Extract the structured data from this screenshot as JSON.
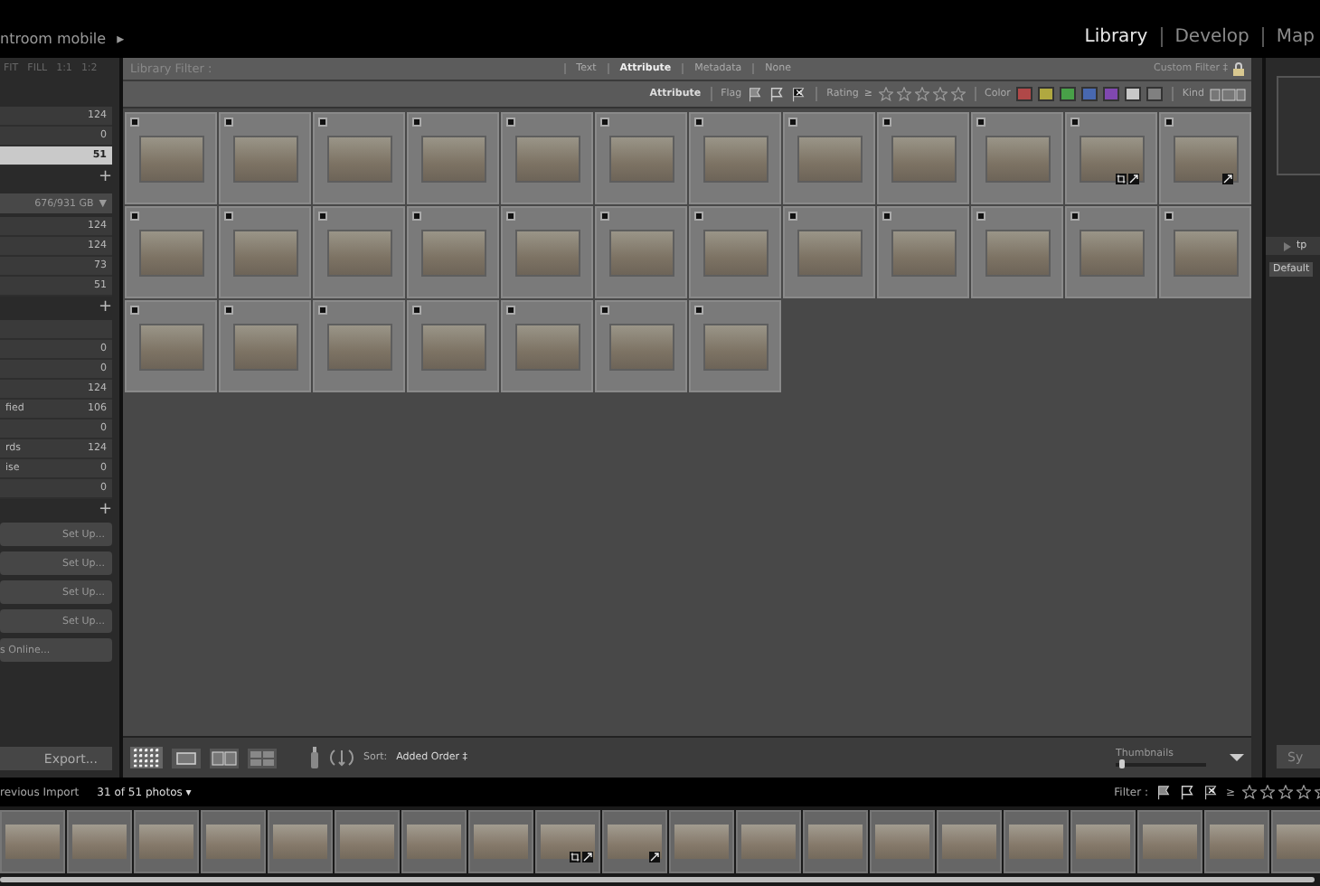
{
  "top_bar": {
    "identity": "ntroom mobile",
    "identity_arrow": "▸",
    "modules": [
      {
        "label": "Library",
        "selected": true
      },
      {
        "label": "Develop",
        "selected": false
      },
      {
        "label": "Map",
        "selected": false
      }
    ]
  },
  "left_panel": {
    "zoom_options": [
      "FIT",
      "FILL",
      "1:1",
      "1:2"
    ],
    "catalog_rows": [
      {
        "count": "124",
        "selected": false
      },
      {
        "count": "0",
        "selected": false
      },
      {
        "count": "51",
        "selected": true
      }
    ],
    "folders": {
      "add": "+",
      "volume": "676/931 GB",
      "volume_arrow": "▼",
      "rows": [
        {
          "count": "124"
        },
        {
          "count": "124"
        },
        {
          "count": "73"
        },
        {
          "count": "51"
        }
      ]
    },
    "collections": {
      "add": "+",
      "rows": [
        {
          "count": "0"
        },
        {
          "count": "0"
        },
        {
          "count": "124"
        },
        {
          "label": "fied",
          "count": "106"
        },
        {
          "count": "0"
        },
        {
          "label": "rds",
          "count": "124"
        },
        {
          "label": "ise",
          "count": "0"
        },
        {
          "count": "0"
        }
      ]
    },
    "publish": {
      "add": "+",
      "services": [
        {
          "action": "Set Up..."
        },
        {
          "action": "Set Up..."
        },
        {
          "action": "Set Up..."
        },
        {
          "action": "Set Up..."
        }
      ],
      "find_more": "s Online..."
    },
    "export_button": "Export..."
  },
  "center": {
    "filter_bar": {
      "title": "Library Filter :",
      "tabs": [
        {
          "label": "Text",
          "selected": false
        },
        {
          "label": "Attribute",
          "selected": true
        },
        {
          "label": "Metadata",
          "selected": false
        },
        {
          "label": "None",
          "selected": false
        }
      ],
      "preset": "Custom Filter ‡"
    },
    "attribute_bar": {
      "label": "Attribute",
      "flag_label": "Flag",
      "rating_label": "Rating",
      "rating_op": "≥",
      "stars": 0,
      "color_label": "Color",
      "colors": [
        {
          "color": "#b04848"
        },
        {
          "color": "#b0a840"
        },
        {
          "color": "#48a048"
        },
        {
          "color": "#4868b0"
        },
        {
          "color": "#8048b0"
        },
        {
          "color": "#c8c8c8"
        },
        {
          "color": "#808080"
        }
      ],
      "kind_label": "Kind"
    },
    "photos": [
      {
        "adjusted": false,
        "cropped": false
      },
      {
        "adjusted": false,
        "cropped": false
      },
      {
        "adjusted": false,
        "cropped": false
      },
      {
        "adjusted": false,
        "cropped": false
      },
      {
        "adjusted": false,
        "cropped": false
      },
      {
        "adjusted": false,
        "cropped": false
      },
      {
        "adjusted": false,
        "cropped": false
      },
      {
        "adjusted": false,
        "cropped": false
      },
      {
        "adjusted": false,
        "cropped": false
      },
      {
        "adjusted": false,
        "cropped": false
      },
      {
        "adjusted": true,
        "cropped": true
      },
      {
        "adjusted": true,
        "cropped": false
      },
      {
        "adjusted": false,
        "cropped": false
      },
      {
        "adjusted": false,
        "cropped": false
      },
      {
        "adjusted": false,
        "cropped": false
      },
      {
        "adjusted": false,
        "cropped": false
      },
      {
        "adjusted": false,
        "cropped": false
      },
      {
        "adjusted": false,
        "cropped": false
      },
      {
        "adjusted": false,
        "cropped": false
      },
      {
        "adjusted": false,
        "cropped": false
      },
      {
        "adjusted": false,
        "cropped": false
      },
      {
        "adjusted": false,
        "cropped": false
      },
      {
        "adjusted": false,
        "cropped": false
      },
      {
        "adjusted": false,
        "cropped": false
      },
      {
        "adjusted": false,
        "cropped": false
      },
      {
        "adjusted": false,
        "cropped": false
      },
      {
        "adjusted": false,
        "cropped": false
      },
      {
        "adjusted": false,
        "cropped": false
      },
      {
        "adjusted": false,
        "cropped": false
      },
      {
        "adjusted": false,
        "cropped": false
      },
      {
        "adjusted": false,
        "cropped": false
      }
    ],
    "toolbar": {
      "sort_label": "Sort:",
      "sort_value": "Added Order",
      "sort_arrow": "‡",
      "thumbnails_label": "Thumbnails",
      "level": 0.05
    }
  },
  "right_panel": {
    "section": "tp",
    "preset": "Default",
    "sync_button": "Sy"
  },
  "filmstrip": {
    "source": "revious Import",
    "count": "31 of 51 photos",
    "count_arrow": "▾",
    "filter_label": "Filter :",
    "rating_op": "≥",
    "stars": 0,
    "photos": [
      {
        "adjusted": false,
        "cropped": false
      },
      {
        "adjusted": false,
        "cropped": false
      },
      {
        "adjusted": false,
        "cropped": false
      },
      {
        "adjusted": false,
        "cropped": false
      },
      {
        "adjusted": false,
        "cropped": false
      },
      {
        "adjusted": false,
        "cropped": false
      },
      {
        "adjusted": false,
        "cropped": false
      },
      {
        "adjusted": false,
        "cropped": false
      },
      {
        "adjusted": true,
        "cropped": true
      },
      {
        "adjusted": true,
        "cropped": false
      },
      {
        "adjusted": false,
        "cropped": false
      },
      {
        "adjusted": false,
        "cropped": false
      },
      {
        "adjusted": false,
        "cropped": false
      },
      {
        "adjusted": false,
        "cropped": false
      },
      {
        "adjusted": false,
        "cropped": false
      },
      {
        "adjusted": false,
        "cropped": false
      },
      {
        "adjusted": false,
        "cropped": false
      },
      {
        "adjusted": false,
        "cropped": false
      },
      {
        "adjusted": false,
        "cropped": false
      },
      {
        "adjusted": false,
        "cropped": false
      }
    ]
  }
}
